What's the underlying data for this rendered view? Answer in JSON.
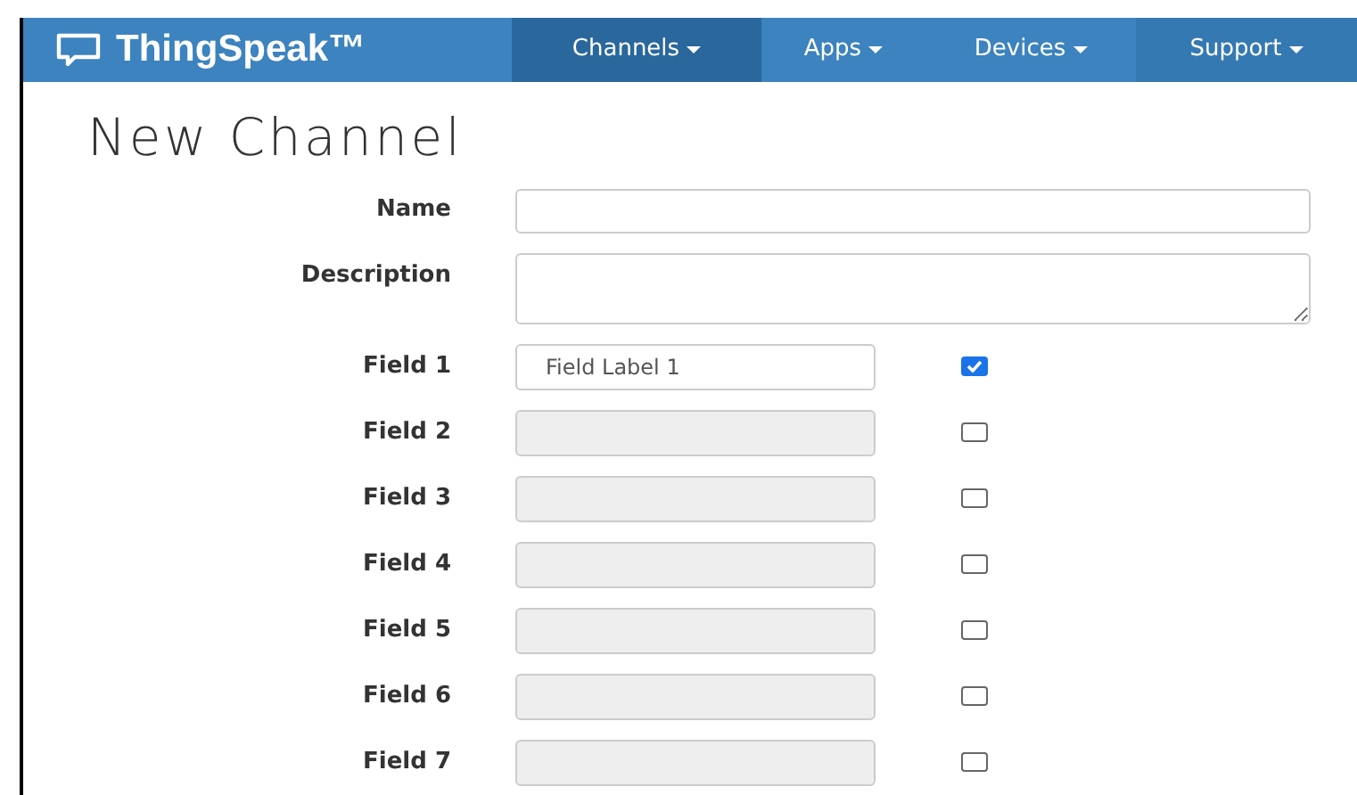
{
  "navbar": {
    "brand": "ThingSpeak™",
    "items": [
      {
        "label": "Channels",
        "selected": true
      },
      {
        "label": "Apps",
        "selected": false
      },
      {
        "label": "Devices",
        "selected": false
      },
      {
        "label": "Support",
        "selected": false
      }
    ]
  },
  "heading": "New Channel",
  "form": {
    "name_label": "Name",
    "description_label": "Description",
    "fields": [
      {
        "label": "Field 1",
        "value": "Field Label 1",
        "checked": true
      },
      {
        "label": "Field 2",
        "checked": false
      },
      {
        "label": "Field 3",
        "checked": false
      },
      {
        "label": "Field 4",
        "checked": false
      },
      {
        "label": "Field 5",
        "checked": false
      },
      {
        "label": "Field 6",
        "checked": false
      },
      {
        "label": "Field 7",
        "checked": false
      }
    ]
  }
}
